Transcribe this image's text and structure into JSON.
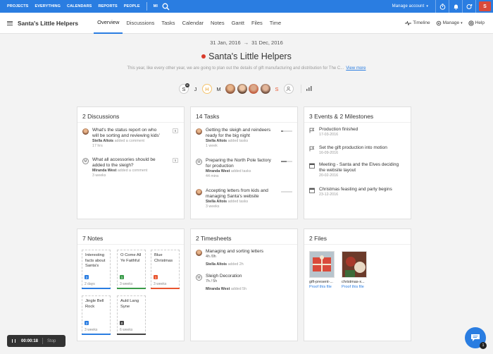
{
  "topnav": {
    "items": [
      "PROJECTS",
      "EVERYTHING",
      "CALENDARS",
      "REPORTS",
      "PEOPLE",
      "MI"
    ],
    "manage_account": "Manage account",
    "avatar_letter": "S"
  },
  "subnav": {
    "project_name": "Santa's Little Helpers",
    "tabs": [
      "Overview",
      "Discussions",
      "Tasks",
      "Calendar",
      "Notes",
      "Gantt",
      "Files",
      "Time"
    ],
    "active_tab": "Overview",
    "timeline": "Timeline",
    "manage": "Manage",
    "help": "Help"
  },
  "header": {
    "start_date": "31 Jan, 2016",
    "arrow": "→",
    "end_date": "31 Dec, 2016",
    "title": "Santa's Little Helpers",
    "description": "This year, like every other year, we are going to plan out the details of gift manufacturing and distribution for The C...",
    "view_more": "View more"
  },
  "people": {
    "letters": [
      "S",
      "J",
      "H",
      "M",
      "S"
    ],
    "mini_badge": "M"
  },
  "discussions": {
    "title": "2 Discussions",
    "items": [
      {
        "text1": "What's the status report on who",
        "text2": "will be sorting and reviewing kids'",
        "author": "Stella Altois",
        "action": "added a comment",
        "time": "17 hrs",
        "count": "6"
      },
      {
        "text1": "What all accessories should be",
        "text2": "added to the sleigh?",
        "author": "Miranda West",
        "action": "added a comment",
        "time": "3 weeks",
        "count": "5",
        "avatar": "M"
      }
    ]
  },
  "tasks": {
    "title": "14 Tasks",
    "items": [
      {
        "text1": "Getting the sleigh and reindeers",
        "text2": "ready for the big night",
        "author": "Stella Altois",
        "action": "added tasks",
        "time": "1 week",
        "progress": 0.2
      },
      {
        "text1": "Preparing the North Pole factory",
        "text2": "for production",
        "author": "Miranda West",
        "action": "added tasks",
        "time": "44 mins",
        "progress": 0.5,
        "avatar": "M"
      },
      {
        "text1": "Accepting letters from kids and",
        "text2": "managing Santa's website",
        "author": "Stella Altois",
        "action": "added tasks",
        "time": "3 weeks",
        "progress": 0.0
      }
    ]
  },
  "events": {
    "title": "3 Events & 2 Milestones",
    "items": [
      {
        "text1": "Production finished",
        "text2": "",
        "date": "17-03-2016",
        "icon": "flag-icon"
      },
      {
        "text1": "Set the gift production into motion",
        "text2": "",
        "date": "16-09-2016",
        "icon": "flag-icon"
      },
      {
        "text1": "Meeting - Santa and the Elves deciding",
        "text2": "the website layout",
        "date": "20-02-2016",
        "icon": "calendar-icon"
      },
      {
        "text1": "Christmas feasting and party begins",
        "text2": "",
        "date": "23-12-2016",
        "icon": "calendar-icon"
      }
    ]
  },
  "notes": {
    "title": "7 Notes",
    "items": [
      {
        "lines": [
          "Interesting",
          "facts about",
          "Santa's"
        ],
        "badge": "2",
        "color": "#2a7de1",
        "foot": "2 days"
      },
      {
        "lines": [
          "O Come All",
          "Ye Faithful"
        ],
        "badge": "1",
        "color": "#3a9b4a",
        "foot": "3 weeks"
      },
      {
        "lines": [
          "Blue",
          "Christmas"
        ],
        "badge": "1",
        "color": "#e8542e",
        "foot": "3 weeks"
      },
      {
        "lines": [
          "Jingle Bell",
          "Rock"
        ],
        "badge": "2",
        "color": "#2a7de1",
        "foot": "3 weeks"
      },
      {
        "lines": [
          "Auld Lang",
          "Syne"
        ],
        "badge": "0",
        "color": "#444444",
        "foot": "6 weeks"
      }
    ]
  },
  "timesheets": {
    "title": "2 Timesheets",
    "items": [
      {
        "text": "Managing and sorting letters",
        "hours": "4h /0h",
        "author": "Stella Altois",
        "action": "added 2h"
      },
      {
        "text": "Sleigh Decoration",
        "hours": "7h / 5h",
        "author": "Miranda West",
        "action": "added 5h",
        "avatar": "M"
      }
    ]
  },
  "files": {
    "title": "2 Files",
    "items": [
      {
        "name": "gift-present-...",
        "proof": "Proof this file"
      },
      {
        "name": "christmas-x...",
        "proof": "Proof this file"
      }
    ]
  },
  "timer": {
    "value": "00:00:18",
    "stop": "Stop"
  },
  "chat": {
    "badge": "1"
  }
}
